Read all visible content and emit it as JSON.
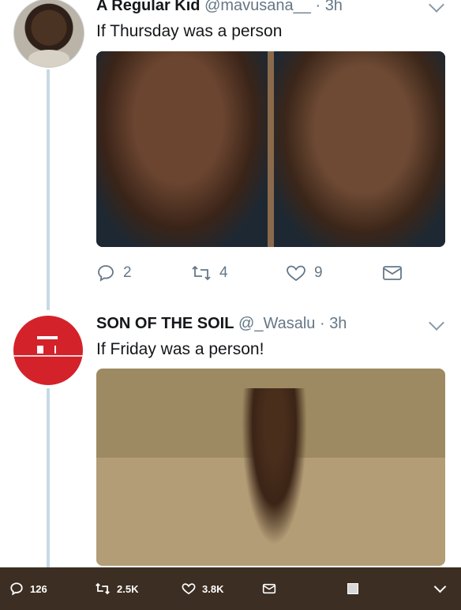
{
  "tweets": [
    {
      "name": "A Regular Kid",
      "handle": "@mavusana__",
      "separator": "·",
      "time": "3h",
      "text": "If Thursday was a person",
      "replies": "2",
      "retweets": "4",
      "likes": "9"
    },
    {
      "name": "SON OF THE SOIL",
      "handle": "@_Wasalu",
      "separator": "·",
      "time": "3h",
      "text": "If Friday was a person!"
    }
  ],
  "bottom_bar": {
    "replies": "126",
    "retweets": "2.5K",
    "likes": "3.8K"
  },
  "colors": {
    "thread_line": "#c6d9e6",
    "meta_gray": "#657786",
    "bottom_bar_bg": "#3c2e22",
    "avatar_red": "#d4222a"
  }
}
